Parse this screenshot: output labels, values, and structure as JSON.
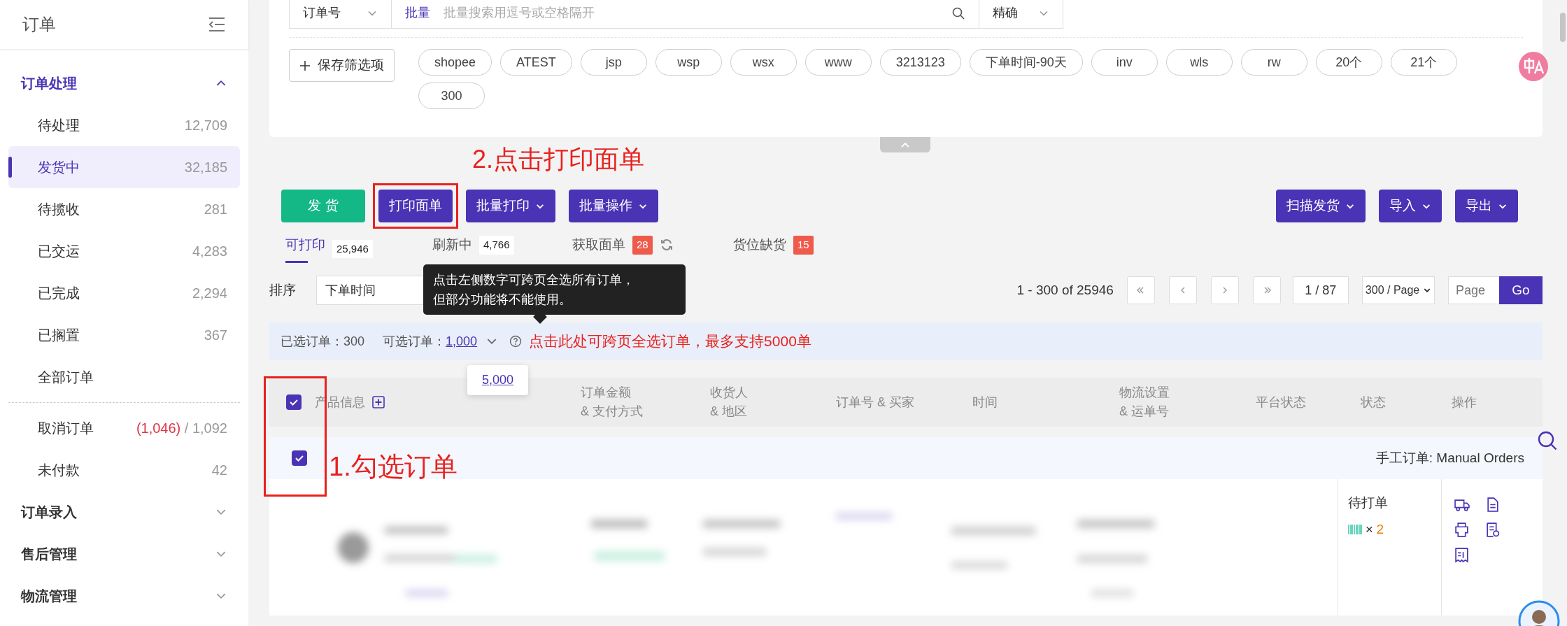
{
  "sidebar": {
    "title": "订单",
    "groups": [
      {
        "label": "订单处理",
        "expanded": true,
        "items": [
          {
            "label": "待处理",
            "count": "12,709",
            "selected": false
          },
          {
            "label": "发货中",
            "count": "32,185",
            "selected": true
          },
          {
            "label": "待揽收",
            "count": "281",
            "selected": false
          },
          {
            "label": "已交运",
            "count": "4,283",
            "selected": false
          },
          {
            "label": "已完成",
            "count": "2,294",
            "selected": false
          },
          {
            "label": "已搁置",
            "count": "367",
            "selected": false
          },
          {
            "label": "全部订单",
            "selected": false
          }
        ],
        "more_items": [
          {
            "label": "取消订单",
            "alert_count": "(1,046)",
            "separator": "/",
            "count": "1,092",
            "selected": false
          },
          {
            "label": "未付款",
            "count": "42",
            "selected": false
          }
        ]
      },
      {
        "label": "订单录入",
        "expanded": false
      },
      {
        "label": "售后管理",
        "expanded": false
      },
      {
        "label": "物流管理",
        "expanded": false
      }
    ]
  },
  "filter": {
    "field": "订单号",
    "mode": "批量",
    "placeholder": "批量搜索用逗号或空格隔开",
    "match": "精确",
    "save_button": "保存筛选项",
    "tags": [
      "shopee",
      "ATEST",
      "jsp",
      "wsp",
      "wsx",
      "www",
      "3213123",
      "下单时间-90天",
      "inv",
      "wls",
      "rw",
      "20个",
      "21个",
      "300"
    ]
  },
  "print_hint": "2.点击打印面单",
  "select_hint": "1.勾选订单",
  "toolbar": {
    "left": [
      {
        "label": "发 货",
        "kind": "primary",
        "dropdown": false,
        "highlighted": false
      },
      {
        "label": "打印面单",
        "kind": "secondary",
        "dropdown": false,
        "highlighted": true
      },
      {
        "label": "批量打印",
        "kind": "secondary",
        "dropdown": true,
        "highlighted": false
      },
      {
        "label": "批量操作",
        "kind": "secondary",
        "dropdown": true,
        "highlighted": false
      }
    ],
    "right": [
      {
        "label": "扫描发货",
        "kind": "secondary",
        "dropdown": true,
        "highlighted": false
      },
      {
        "label": "导入",
        "kind": "secondary",
        "dropdown": true,
        "highlighted": false
      },
      {
        "label": "导出",
        "kind": "secondary",
        "dropdown": true,
        "highlighted": false
      }
    ]
  },
  "status_tabs": [
    {
      "label": "可打印",
      "count": "25,946",
      "kind": "plain",
      "selected": true,
      "refresh": false
    },
    {
      "label": "刷新中",
      "count": "4,766",
      "kind": "plain",
      "selected": false,
      "refresh": false
    },
    {
      "label": "获取面单",
      "count": "28",
      "kind": "alert",
      "selected": false,
      "refresh": true
    },
    {
      "label": "货位缺货",
      "count": "15",
      "kind": "alert",
      "selected": false,
      "refresh": false
    }
  ],
  "sort": {
    "label": "排序",
    "value": "下单时间"
  },
  "tooltip": {
    "lines": [
      "点击左侧数字可跨页全选所有订单，",
      "但部分功能将不能使用。"
    ]
  },
  "pagination": {
    "range": "1 - 300 of 25946",
    "page": "1 / 87",
    "page_size": "300 / Page",
    "page_placeholder": "Page",
    "go": "Go"
  },
  "selection": {
    "selected": "已选订单：300",
    "selectable_label": "可选订单：",
    "selectable_value": "1,000",
    "hint": "点击此处可跨页全选订单，最多支持5000单",
    "options": [
      "5,000"
    ]
  },
  "table": {
    "select_all": true,
    "columns": [
      {
        "lines": [
          "产品信息"
        ],
        "kind": "expandable"
      },
      {
        "lines": [
          "订单金额",
          "& 支付方式"
        ],
        "kind": "plain"
      },
      {
        "lines": [
          "收货人",
          "& 地区"
        ],
        "kind": "plain"
      },
      {
        "lines": [
          "订单号 & 买家"
        ],
        "kind": "plain"
      },
      {
        "lines": [
          "时间"
        ],
        "kind": "plain"
      },
      {
        "lines": [
          "物流设置",
          "& 运单号"
        ],
        "kind": "plain"
      },
      {
        "lines": [
          "平台状态"
        ],
        "kind": "plain"
      },
      {
        "lines": [
          "状态"
        ],
        "kind": "plain"
      },
      {
        "lines": [
          "操作"
        ],
        "kind": "plain"
      }
    ],
    "rows": [
      {
        "checked": true,
        "source": "手工订单: Manual Orders",
        "status": "待打单",
        "quantity_sign": "×",
        "quantity": "2"
      }
    ]
  }
}
